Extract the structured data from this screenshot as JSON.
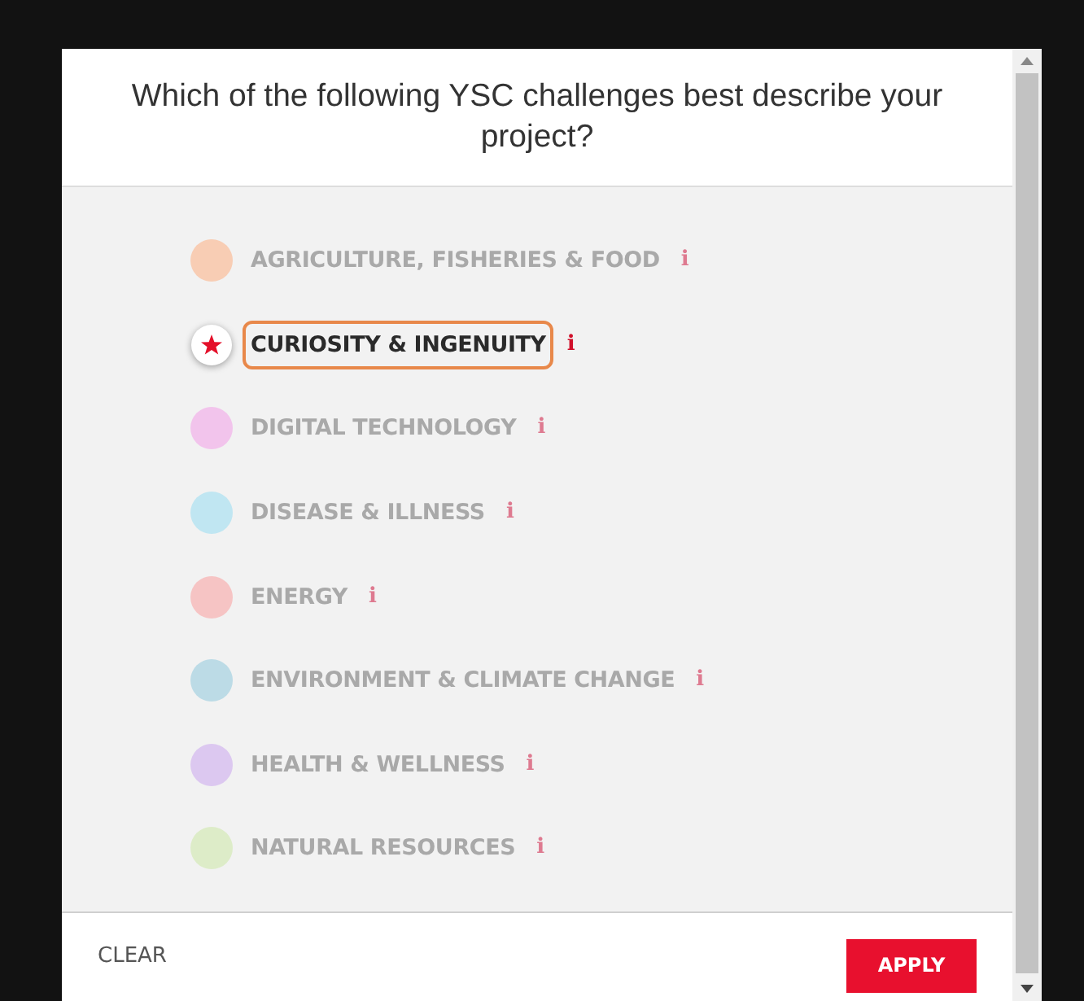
{
  "dialog": {
    "title": "Which of the following YSC challenges best describe your project?"
  },
  "challenges": [
    {
      "label": "AGRICULTURE, FISHERIES & FOOD",
      "info": "i",
      "selected": false,
      "color": "#f8cdb4"
    },
    {
      "label": "CURIOSITY & INGENUITY",
      "info": "i",
      "selected": true,
      "color": "#e4102a"
    },
    {
      "label": "DIGITAL TECHNOLOGY",
      "info": "i",
      "selected": false,
      "color": "#f2c4ec"
    },
    {
      "label": "DISEASE & ILLNESS",
      "info": "i",
      "selected": false,
      "color": "#c0e6f2"
    },
    {
      "label": "ENERGY",
      "info": "i",
      "selected": false,
      "color": "#f6c4c4"
    },
    {
      "label": "ENVIRONMENT & CLIMATE CHANGE",
      "info": "i",
      "selected": false,
      "color": "#bcdbe6"
    },
    {
      "label": "HEALTH & WELLNESS",
      "info": "i",
      "selected": false,
      "color": "#dcc8f0"
    },
    {
      "label": "NATURAL RESOURCES",
      "info": "i",
      "selected": false,
      "color": "#ddecc8"
    }
  ],
  "footer": {
    "clear": "CLEAR",
    "apply": "APPLY"
  }
}
